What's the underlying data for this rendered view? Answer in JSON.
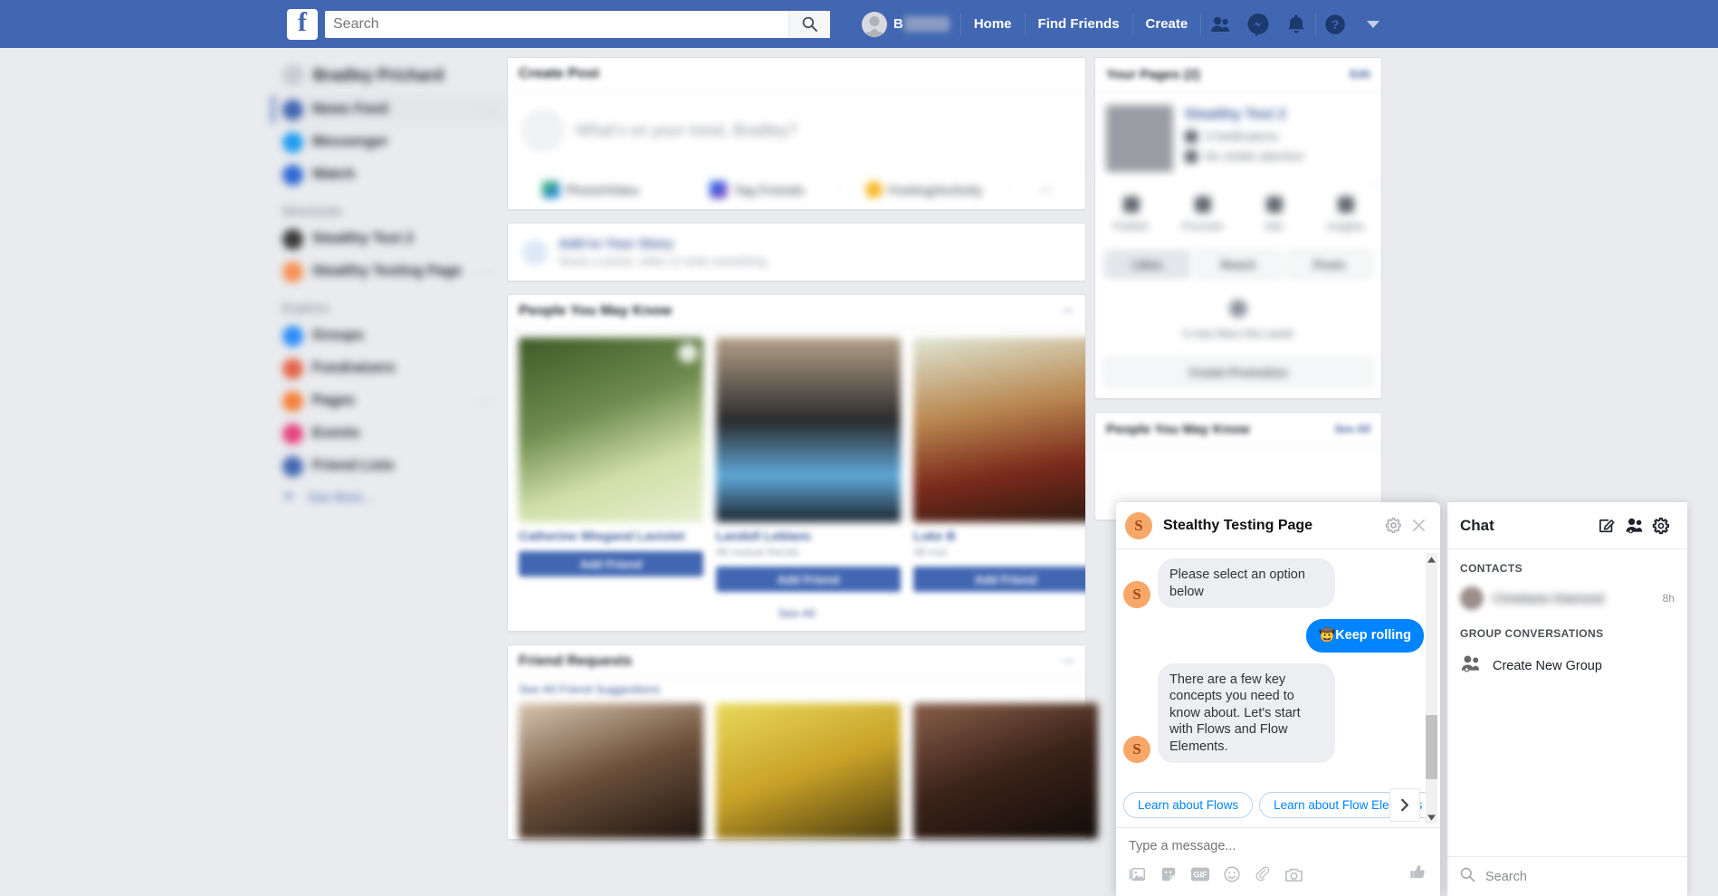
{
  "topnav": {
    "logo": "f",
    "search_placeholder": "Search",
    "search_value": "",
    "search_icon": "search-icon",
    "profile_name": "B",
    "links": [
      {
        "label": "Home"
      },
      {
        "label": "Find Friends"
      },
      {
        "label": "Create"
      }
    ],
    "icons": [
      {
        "name": "friend-requests-icon"
      },
      {
        "name": "messenger-icon"
      },
      {
        "name": "notifications-icon"
      },
      {
        "name": "help-icon"
      },
      {
        "name": "account-menu-icon"
      }
    ]
  },
  "sidebar": {
    "user_name": "Bradley Prichard",
    "main_items": [
      {
        "label": "News Feed",
        "color": "#4267b2",
        "active": true,
        "dots": "···"
      },
      {
        "label": "Messenger",
        "color": "#1e9bf0",
        "active": false,
        "dots": ""
      },
      {
        "label": "Watch",
        "color": "#2f66d5",
        "active": false,
        "dots": ""
      }
    ],
    "shortcuts_header": "Shortcuts",
    "shortcuts": [
      {
        "label": "Stealthy Test 2",
        "color": "#3a3a3a",
        "dots": ""
      },
      {
        "label": "Stealthy Testing Page",
        "color": "#f79053",
        "dots": "···"
      }
    ],
    "explore_header": "Explore",
    "explore": [
      {
        "label": "Groups",
        "color": "#2a8cf8",
        "dots": ""
      },
      {
        "label": "Fundraisers",
        "color": "#e5644a",
        "dots": ""
      },
      {
        "label": "Pages",
        "color": "#f7803c",
        "dots": "···"
      },
      {
        "label": "Events",
        "color": "#e5437e",
        "dots": ""
      },
      {
        "label": "Friend Lists",
        "color": "#4267b2",
        "dots": ""
      }
    ],
    "see_more": "See More..."
  },
  "feed": {
    "create_post": {
      "title": "Create Post",
      "placeholder": "What's on your mind, Bradley?",
      "actions": [
        {
          "label": "Photo/Video",
          "color": "#45bd62"
        },
        {
          "label": "Tag Friends",
          "color": "#1877f2"
        },
        {
          "label": "Feeling/Activity",
          "color": "#f7b928"
        },
        {
          "label": "···",
          "color": "transparent"
        }
      ]
    },
    "story": {
      "title": "Add to Your Story",
      "subtitle": "Share a photo, video or write something"
    },
    "pymk": {
      "title": "People You May Know",
      "header_action": "···",
      "people": [
        {
          "name": "Catherine Wiegand Laviolet",
          "mutual": "",
          "button": "Add Friend"
        },
        {
          "name": "Landell Leblanc",
          "mutual": "46 mutual friends",
          "button": "Add Friend"
        },
        {
          "name": "Luke B",
          "mutual": "38 mut",
          "button": "Add Friend"
        }
      ],
      "see_all": "See All"
    },
    "friend_requests": {
      "title": "Friend Requests",
      "subtitle": "See All Friend Suggestions",
      "header_action": "···"
    }
  },
  "right_column": {
    "your_pages": {
      "title": "Your Pages (2)",
      "header_action": "Edit",
      "page_name": "Stealthy Test 2",
      "thumb_letter": "S",
      "meta": [
        "3 Notifications",
        "No visible attention"
      ],
      "stats": [
        {
          "label": "Publish"
        },
        {
          "label": "Promote"
        },
        {
          "label": "Ads"
        },
        {
          "label": "Insights"
        }
      ],
      "tabs": [
        {
          "label": "Likes",
          "selected": true
        },
        {
          "label": "Reach",
          "selected": false
        },
        {
          "label": "Posts",
          "selected": false
        }
      ],
      "empty_text": "0 new likes this week",
      "promote_label": "Create Promotion"
    },
    "pymk_title": "People You May Know",
    "pymk_action": "See All"
  },
  "chat_window": {
    "avatar_letter": "S",
    "title": "Stealthy Testing Page",
    "settings_icon": "gear-icon",
    "close_icon": "close-icon",
    "messages": [
      {
        "from": "page",
        "avatar": "S",
        "show_avatar": true,
        "text": "Please select an option below"
      },
      {
        "from": "user",
        "avatar": "",
        "show_avatar": false,
        "text": "🤠Keep rolling"
      },
      {
        "from": "page",
        "avatar": "S",
        "show_avatar": true,
        "text": "There are a few key concepts you need to know about. Let's start with Flows and Flow Elements."
      }
    ],
    "quick_replies": [
      {
        "label": "Learn about Flows"
      },
      {
        "label": "Learn about Flow Elements"
      }
    ],
    "next_icon": "chevron-right-icon",
    "composer_placeholder": "Type a message...",
    "composer_value": "",
    "composer_icons": [
      {
        "name": "image-icon"
      },
      {
        "name": "sticker-icon"
      },
      {
        "name": "gif-icon",
        "label": "GIF"
      },
      {
        "name": "emoji-icon"
      },
      {
        "name": "attachment-icon"
      },
      {
        "name": "camera-icon"
      }
    ],
    "send_icon": "thumbs-up-icon"
  },
  "chat_sidebar": {
    "title": "Chat",
    "header_icons": [
      {
        "name": "compose-icon"
      },
      {
        "name": "new-group-icon"
      },
      {
        "name": "gear-icon"
      }
    ],
    "contacts_header": "CONTACTS",
    "contacts": [
      {
        "name": "Christiane Diamond",
        "time": "8h"
      }
    ],
    "groups_header": "GROUP CONVERSATIONS",
    "create_group_label": "Create New Group",
    "search_placeholder": "Search",
    "search_icon": "search-icon"
  },
  "colors": {
    "fb_blue": "#4267b2",
    "messenger_blue": "#0084ff",
    "link_blue": "#385898",
    "page_bg": "#e9ebee",
    "avatar_orange": "#f7a868"
  }
}
